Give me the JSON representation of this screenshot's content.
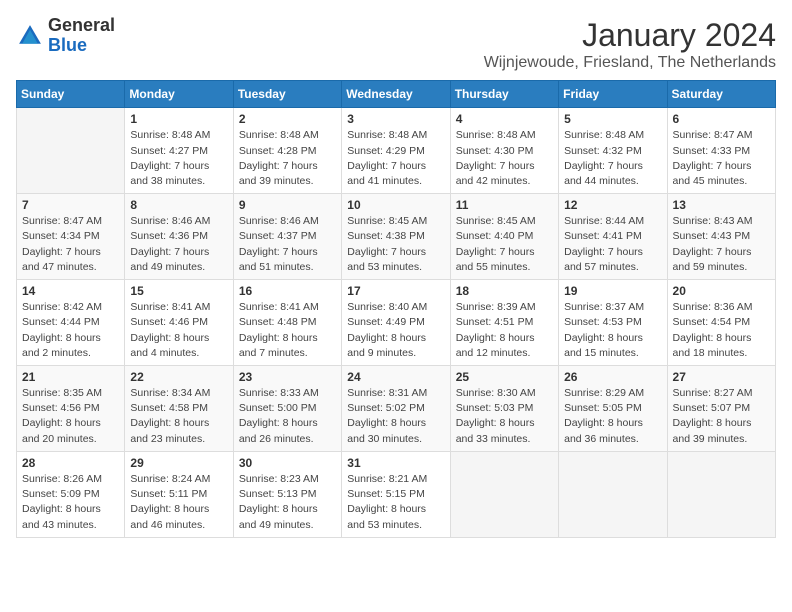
{
  "logo": {
    "text_general": "General",
    "text_blue": "Blue"
  },
  "title": "January 2024",
  "subtitle": "Wijnjewoude, Friesland, The Netherlands",
  "days_of_week": [
    "Sunday",
    "Monday",
    "Tuesday",
    "Wednesday",
    "Thursday",
    "Friday",
    "Saturday"
  ],
  "weeks": [
    [
      {
        "day": "",
        "info": ""
      },
      {
        "day": "1",
        "info": "Sunrise: 8:48 AM\nSunset: 4:27 PM\nDaylight: 7 hours\nand 38 minutes."
      },
      {
        "day": "2",
        "info": "Sunrise: 8:48 AM\nSunset: 4:28 PM\nDaylight: 7 hours\nand 39 minutes."
      },
      {
        "day": "3",
        "info": "Sunrise: 8:48 AM\nSunset: 4:29 PM\nDaylight: 7 hours\nand 41 minutes."
      },
      {
        "day": "4",
        "info": "Sunrise: 8:48 AM\nSunset: 4:30 PM\nDaylight: 7 hours\nand 42 minutes."
      },
      {
        "day": "5",
        "info": "Sunrise: 8:48 AM\nSunset: 4:32 PM\nDaylight: 7 hours\nand 44 minutes."
      },
      {
        "day": "6",
        "info": "Sunrise: 8:47 AM\nSunset: 4:33 PM\nDaylight: 7 hours\nand 45 minutes."
      }
    ],
    [
      {
        "day": "7",
        "info": "Sunrise: 8:47 AM\nSunset: 4:34 PM\nDaylight: 7 hours\nand 47 minutes."
      },
      {
        "day": "8",
        "info": "Sunrise: 8:46 AM\nSunset: 4:36 PM\nDaylight: 7 hours\nand 49 minutes."
      },
      {
        "day": "9",
        "info": "Sunrise: 8:46 AM\nSunset: 4:37 PM\nDaylight: 7 hours\nand 51 minutes."
      },
      {
        "day": "10",
        "info": "Sunrise: 8:45 AM\nSunset: 4:38 PM\nDaylight: 7 hours\nand 53 minutes."
      },
      {
        "day": "11",
        "info": "Sunrise: 8:45 AM\nSunset: 4:40 PM\nDaylight: 7 hours\nand 55 minutes."
      },
      {
        "day": "12",
        "info": "Sunrise: 8:44 AM\nSunset: 4:41 PM\nDaylight: 7 hours\nand 57 minutes."
      },
      {
        "day": "13",
        "info": "Sunrise: 8:43 AM\nSunset: 4:43 PM\nDaylight: 7 hours\nand 59 minutes."
      }
    ],
    [
      {
        "day": "14",
        "info": "Sunrise: 8:42 AM\nSunset: 4:44 PM\nDaylight: 8 hours\nand 2 minutes."
      },
      {
        "day": "15",
        "info": "Sunrise: 8:41 AM\nSunset: 4:46 PM\nDaylight: 8 hours\nand 4 minutes."
      },
      {
        "day": "16",
        "info": "Sunrise: 8:41 AM\nSunset: 4:48 PM\nDaylight: 8 hours\nand 7 minutes."
      },
      {
        "day": "17",
        "info": "Sunrise: 8:40 AM\nSunset: 4:49 PM\nDaylight: 8 hours\nand 9 minutes."
      },
      {
        "day": "18",
        "info": "Sunrise: 8:39 AM\nSunset: 4:51 PM\nDaylight: 8 hours\nand 12 minutes."
      },
      {
        "day": "19",
        "info": "Sunrise: 8:37 AM\nSunset: 4:53 PM\nDaylight: 8 hours\nand 15 minutes."
      },
      {
        "day": "20",
        "info": "Sunrise: 8:36 AM\nSunset: 4:54 PM\nDaylight: 8 hours\nand 18 minutes."
      }
    ],
    [
      {
        "day": "21",
        "info": "Sunrise: 8:35 AM\nSunset: 4:56 PM\nDaylight: 8 hours\nand 20 minutes."
      },
      {
        "day": "22",
        "info": "Sunrise: 8:34 AM\nSunset: 4:58 PM\nDaylight: 8 hours\nand 23 minutes."
      },
      {
        "day": "23",
        "info": "Sunrise: 8:33 AM\nSunset: 5:00 PM\nDaylight: 8 hours\nand 26 minutes."
      },
      {
        "day": "24",
        "info": "Sunrise: 8:31 AM\nSunset: 5:02 PM\nDaylight: 8 hours\nand 30 minutes."
      },
      {
        "day": "25",
        "info": "Sunrise: 8:30 AM\nSunset: 5:03 PM\nDaylight: 8 hours\nand 33 minutes."
      },
      {
        "day": "26",
        "info": "Sunrise: 8:29 AM\nSunset: 5:05 PM\nDaylight: 8 hours\nand 36 minutes."
      },
      {
        "day": "27",
        "info": "Sunrise: 8:27 AM\nSunset: 5:07 PM\nDaylight: 8 hours\nand 39 minutes."
      }
    ],
    [
      {
        "day": "28",
        "info": "Sunrise: 8:26 AM\nSunset: 5:09 PM\nDaylight: 8 hours\nand 43 minutes."
      },
      {
        "day": "29",
        "info": "Sunrise: 8:24 AM\nSunset: 5:11 PM\nDaylight: 8 hours\nand 46 minutes."
      },
      {
        "day": "30",
        "info": "Sunrise: 8:23 AM\nSunset: 5:13 PM\nDaylight: 8 hours\nand 49 minutes."
      },
      {
        "day": "31",
        "info": "Sunrise: 8:21 AM\nSunset: 5:15 PM\nDaylight: 8 hours\nand 53 minutes."
      },
      {
        "day": "",
        "info": ""
      },
      {
        "day": "",
        "info": ""
      },
      {
        "day": "",
        "info": ""
      }
    ]
  ]
}
